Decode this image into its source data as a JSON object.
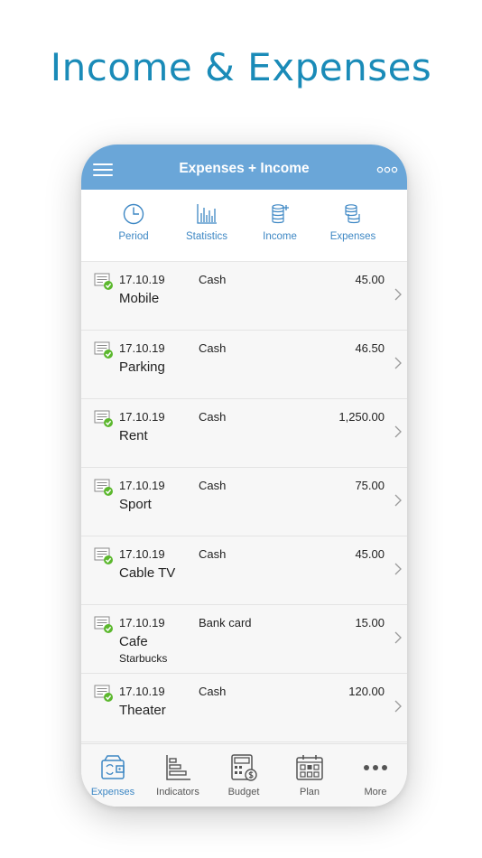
{
  "headline": "Income & Expenses",
  "navbar": {
    "title": "Expenses + Income"
  },
  "tabs": [
    {
      "label": "Period",
      "icon": "clock-icon"
    },
    {
      "label": "Statistics",
      "icon": "bar-chart-icon"
    },
    {
      "label": "Income",
      "icon": "coins-plus-icon"
    },
    {
      "label": "Expenses",
      "icon": "coins-minus-icon"
    }
  ],
  "transactions": [
    {
      "date": "17.10.19",
      "account": "Cash",
      "amount": "45.00",
      "category": "Mobile",
      "note": ""
    },
    {
      "date": "17.10.19",
      "account": "Cash",
      "amount": "46.50",
      "category": "Parking",
      "note": ""
    },
    {
      "date": "17.10.19",
      "account": "Cash",
      "amount": "1,250.00",
      "category": "Rent",
      "note": ""
    },
    {
      "date": "17.10.19",
      "account": "Cash",
      "amount": "75.00",
      "category": "Sport",
      "note": ""
    },
    {
      "date": "17.10.19",
      "account": "Cash",
      "amount": "45.00",
      "category": "Cable TV",
      "note": ""
    },
    {
      "date": "17.10.19",
      "account": "Bank card",
      "amount": "15.00",
      "category": "Cafe",
      "note": "Starbucks"
    },
    {
      "date": "17.10.19",
      "account": "Cash",
      "amount": "120.00",
      "category": "Theater",
      "note": ""
    }
  ],
  "bottom_tabs": [
    {
      "label": "Expenses",
      "icon": "wallet-icon",
      "active": true
    },
    {
      "label": "Indicators",
      "icon": "indicators-icon",
      "active": false
    },
    {
      "label": "Budget",
      "icon": "budget-calculator-icon",
      "active": false
    },
    {
      "label": "Plan",
      "icon": "calendar-icon",
      "active": false
    },
    {
      "label": "More",
      "icon": "more-icon",
      "active": false
    }
  ],
  "colors": {
    "headline": "#1a8bb8",
    "navbar": "#6aa6d8",
    "accent": "#3d87c4",
    "status_check": "#5cb82e"
  }
}
